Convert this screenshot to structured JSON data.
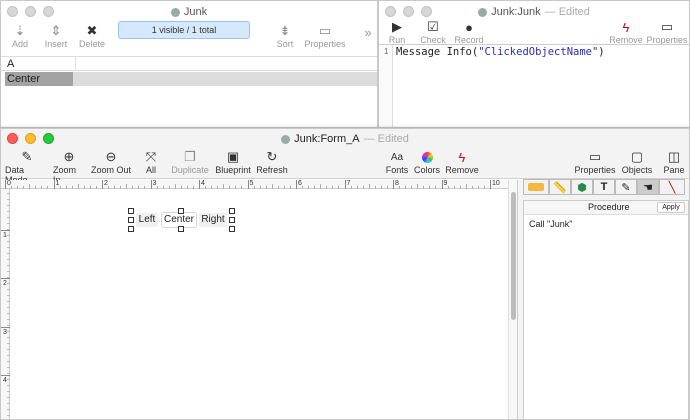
{
  "list_window": {
    "title": "Junk",
    "toolbar": {
      "add": "Add",
      "insert": "Insert",
      "delete": "Delete",
      "selection": "1 visible / 1 total",
      "sort": "Sort",
      "properties": "Properties",
      "more": "»"
    },
    "column_header": "A",
    "rows": [
      "Center"
    ]
  },
  "script_window": {
    "title": "Junk:Junk",
    "edited": "— Edited",
    "toolbar": {
      "run": "Run",
      "check": "Check",
      "record": "Record",
      "remove": "Remove",
      "properties": "Properties"
    },
    "line_number": "1",
    "code_prefix": "Message Info(",
    "code_string": "\"ClickedObjectName\"",
    "code_suffix": ")"
  },
  "form_window": {
    "title": "Junk:Form_A",
    "edited": "— Edited",
    "toolbar": {
      "data_mode": "Data Mode",
      "zoom_in": "Zoom In",
      "zoom_out": "Zoom Out",
      "all": "All",
      "duplicate": "Duplicate",
      "blueprint": "Blueprint",
      "refresh": "Refresh",
      "fonts": "Fonts",
      "colors": "Colors",
      "remove": "Remove",
      "properties": "Properties",
      "objects": "Objects",
      "pane": "Pane"
    },
    "ruler_h": [
      "0",
      "1",
      "2",
      "3",
      "4",
      "5",
      "6",
      "7",
      "8",
      "9",
      "10"
    ],
    "ruler_v": [
      "0",
      "1",
      "2",
      "3",
      "4"
    ],
    "buttons": [
      "Left",
      "Center",
      "Right"
    ],
    "side_pane": {
      "header": "Procedure",
      "apply": "Apply",
      "content": "Call \"Junk\""
    }
  },
  "colors": {
    "accent_red": "#d0021b",
    "selection_blue": "#d6e8fb",
    "code_string": "#2b2bb5"
  }
}
